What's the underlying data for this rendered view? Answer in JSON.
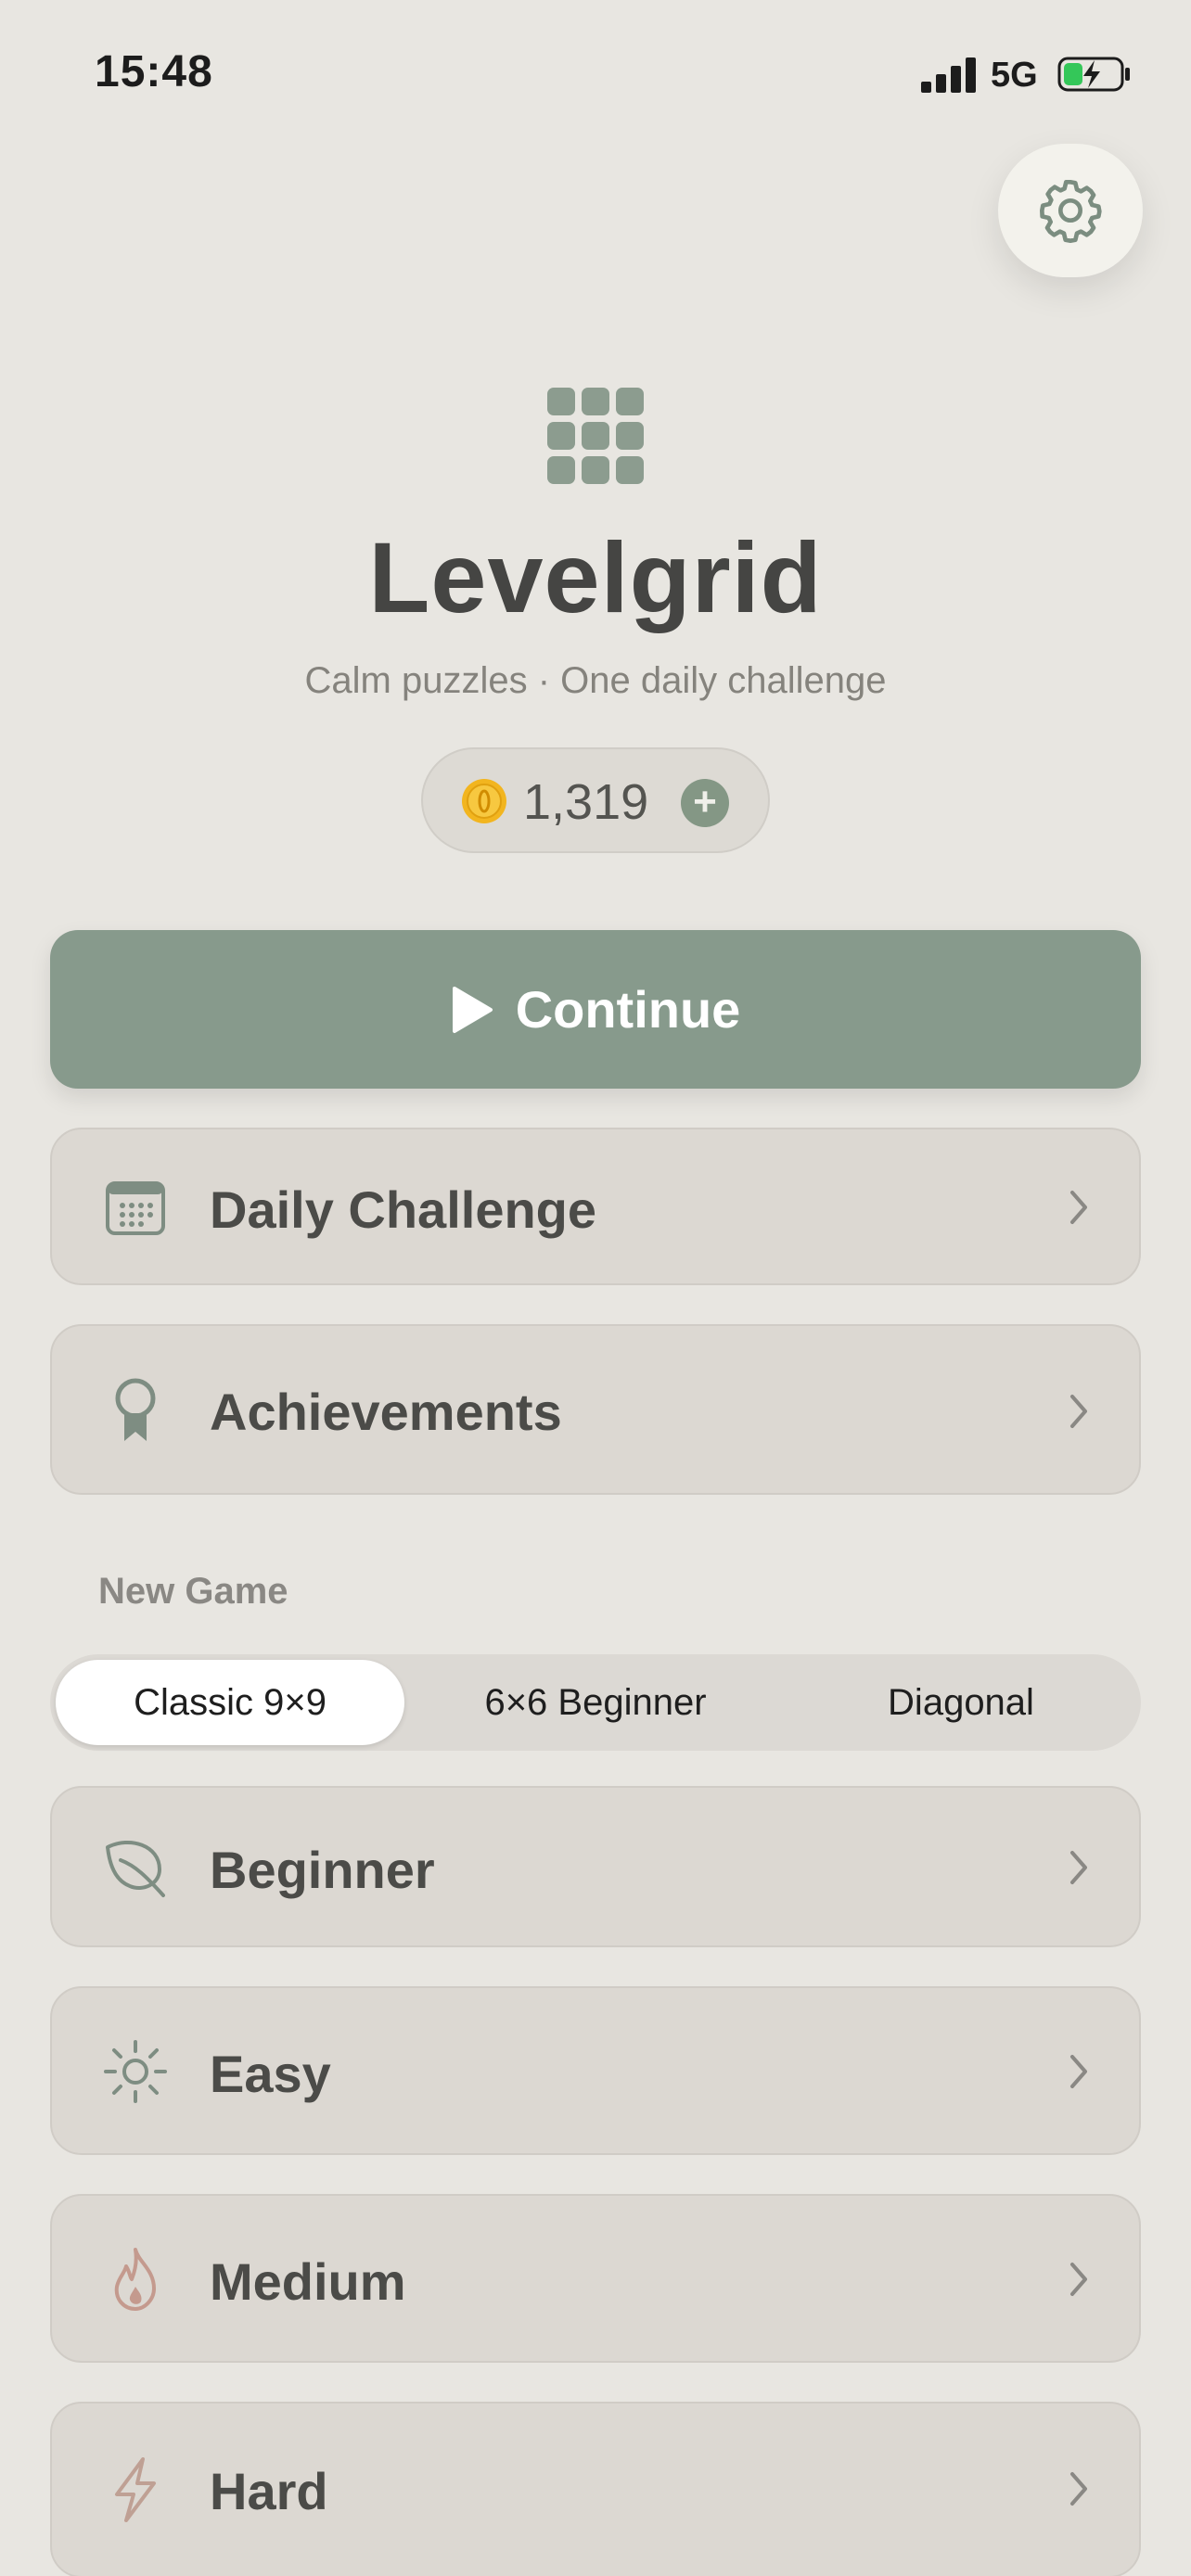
{
  "status_bar": {
    "time": "15:48",
    "network": "5G",
    "signal_icon": "cellular-signal-icon",
    "battery_icon": "battery-charging-icon"
  },
  "settings": {
    "icon": "gear-icon"
  },
  "header": {
    "logo_icon": "grid-3x3-icon",
    "title": "Levelgrid",
    "subtitle": "Calm puzzles · One daily challenge"
  },
  "coins": {
    "amount": "1,319",
    "icon": "coin-icon",
    "add_icon": "plus-icon"
  },
  "primary": {
    "continue_label": "Continue",
    "icon": "play-icon"
  },
  "menu": [
    {
      "label": "Daily Challenge",
      "icon": "calendar-icon"
    },
    {
      "label": "Achievements",
      "icon": "ribbon-badge-icon"
    }
  ],
  "new_game": {
    "section_label": "New Game",
    "modes": [
      "Classic 9×9",
      "6×6 Beginner",
      "Diagonal"
    ],
    "selected_mode": "Classic 9×9",
    "difficulties": [
      {
        "label": "Beginner",
        "icon": "leaf-icon"
      },
      {
        "label": "Easy",
        "icon": "sun-icon"
      },
      {
        "label": "Medium",
        "icon": "flame-icon"
      },
      {
        "label": "Hard",
        "icon": "lightning-bolt-icon"
      }
    ]
  },
  "colors": {
    "background": "#e8e6e1",
    "accent_green": "#879a8c",
    "row_background": "#dcd8d2",
    "flame": "#c49a8e"
  }
}
